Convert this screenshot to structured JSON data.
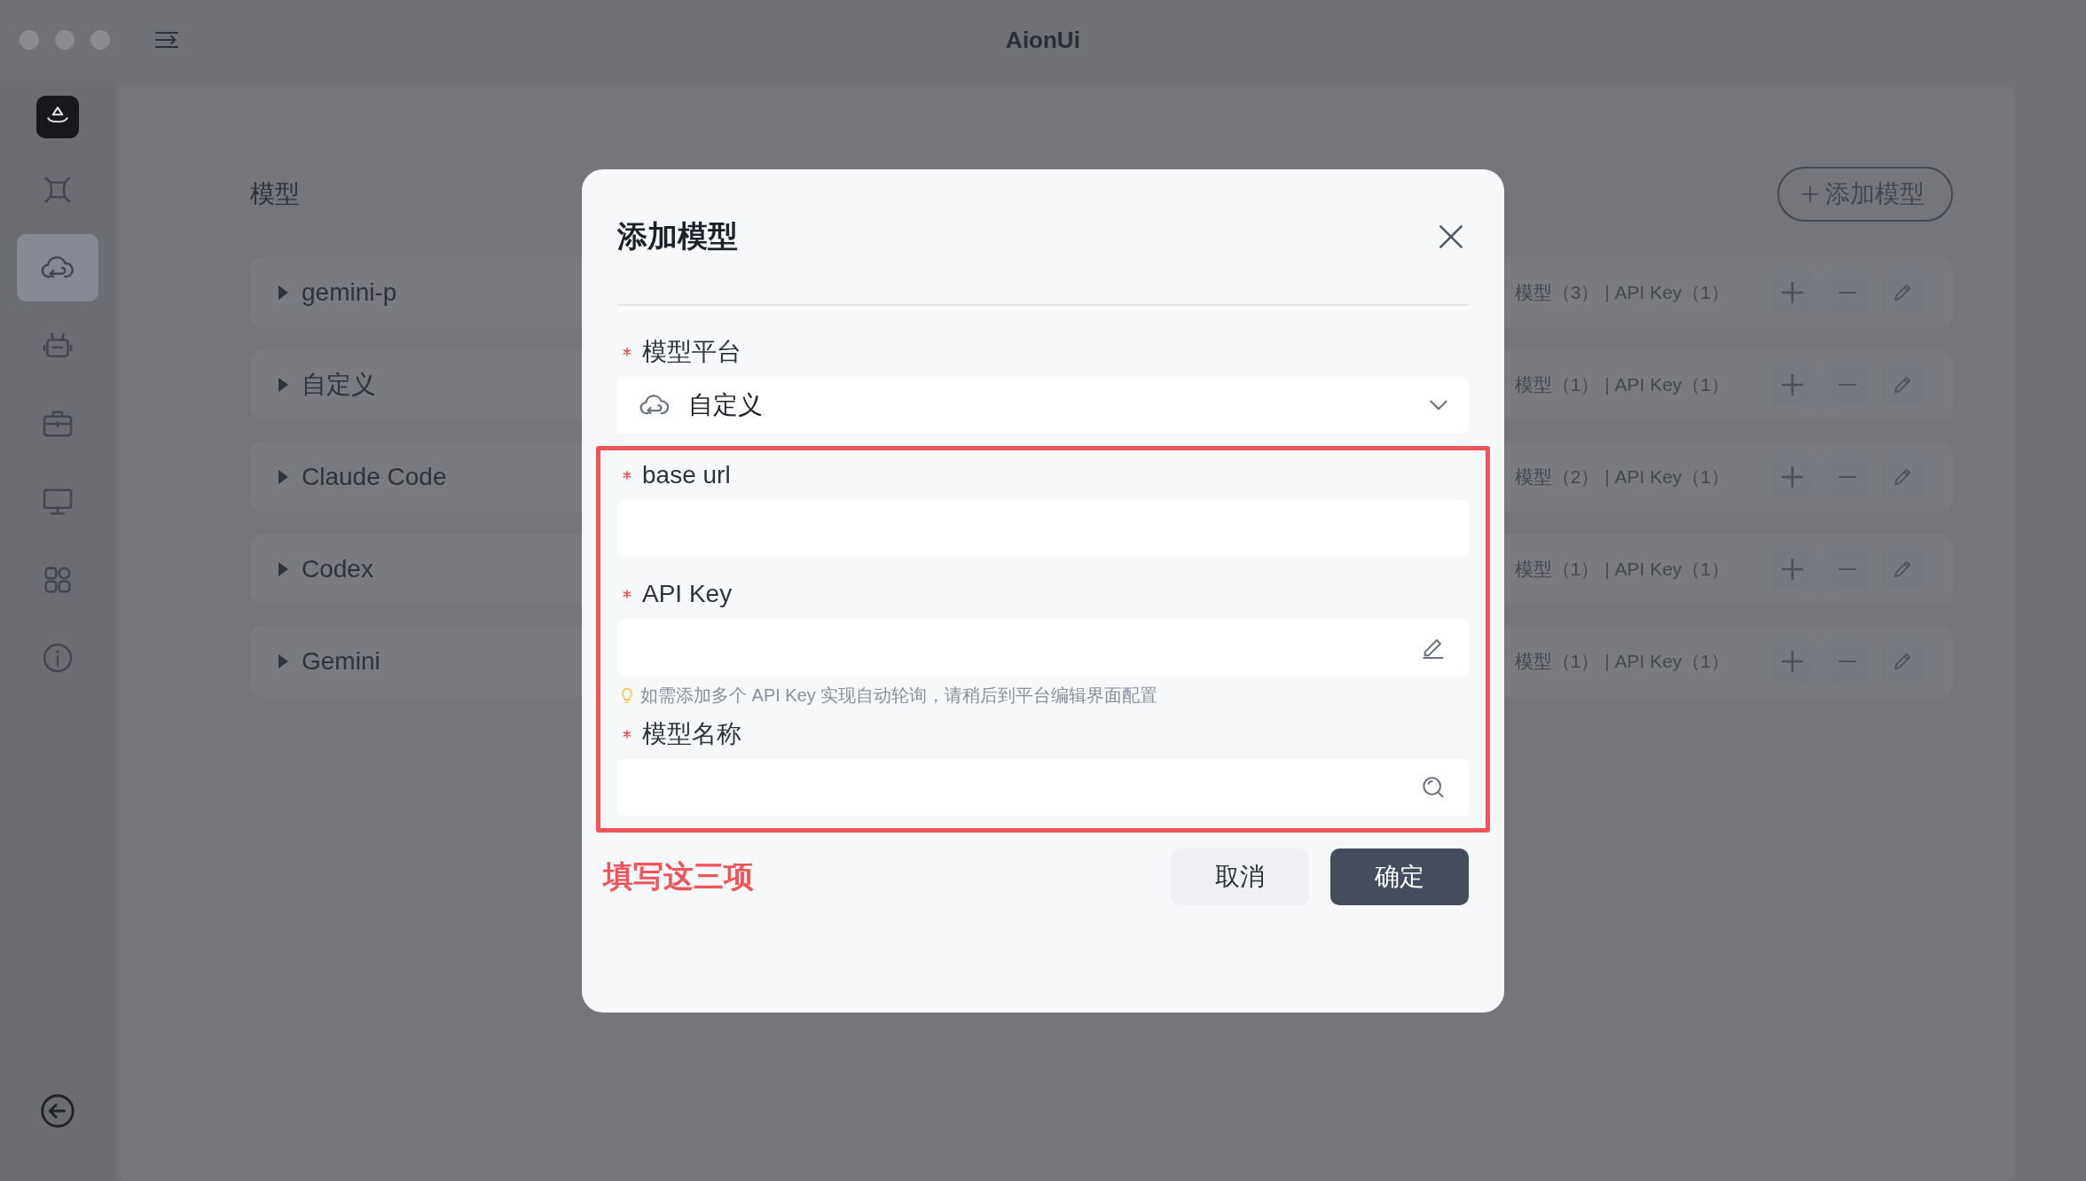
{
  "window": {
    "title": "AionUi"
  },
  "sidebar": {
    "items": [
      {
        "kind": "logo",
        "selected": false
      },
      {
        "kind": "frame",
        "selected": false
      },
      {
        "kind": "cloud",
        "selected": true
      },
      {
        "kind": "robot",
        "selected": false
      },
      {
        "kind": "toolbox",
        "selected": false
      },
      {
        "kind": "monitor",
        "selected": false
      },
      {
        "kind": "grid",
        "selected": false
      },
      {
        "kind": "info",
        "selected": false
      }
    ]
  },
  "content": {
    "title": "模型",
    "add_button": "添加模型",
    "rows": [
      {
        "name": "gemini-p",
        "summary": "模型（3） | API Key（1）",
        "expanded": false
      },
      {
        "name": "自定义",
        "summary": "模型（1） | API Key（1）",
        "expanded": false
      },
      {
        "name": "Claude Code",
        "summary": "模型（2） | API Key（1）",
        "expanded": false
      },
      {
        "name": "Codex",
        "summary": "模型（1） | API Key（1）",
        "expanded": false
      },
      {
        "name": "Gemini",
        "summary": "模型（1） | API Key（1）",
        "expanded": false
      }
    ]
  },
  "dialog": {
    "title": "添加模型",
    "fields": [
      {
        "kind": "select",
        "label": "模型平台",
        "required": true,
        "highlighted": false,
        "value": "自定义"
      },
      {
        "kind": "text",
        "label": "base url",
        "required": true,
        "highlighted": true
      },
      {
        "kind": "key",
        "label": "API Key",
        "required": true,
        "highlighted": true,
        "hint": "如需添加多个 API Key 实现自动轮询，请稍后到平台编辑界面配置"
      },
      {
        "kind": "search",
        "label": "模型名称",
        "required": true,
        "highlighted": true
      }
    ],
    "annotation": "填写这三项",
    "buttons": [
      {
        "label": "取消",
        "primary": false
      },
      {
        "label": "确定",
        "primary": true
      }
    ]
  }
}
